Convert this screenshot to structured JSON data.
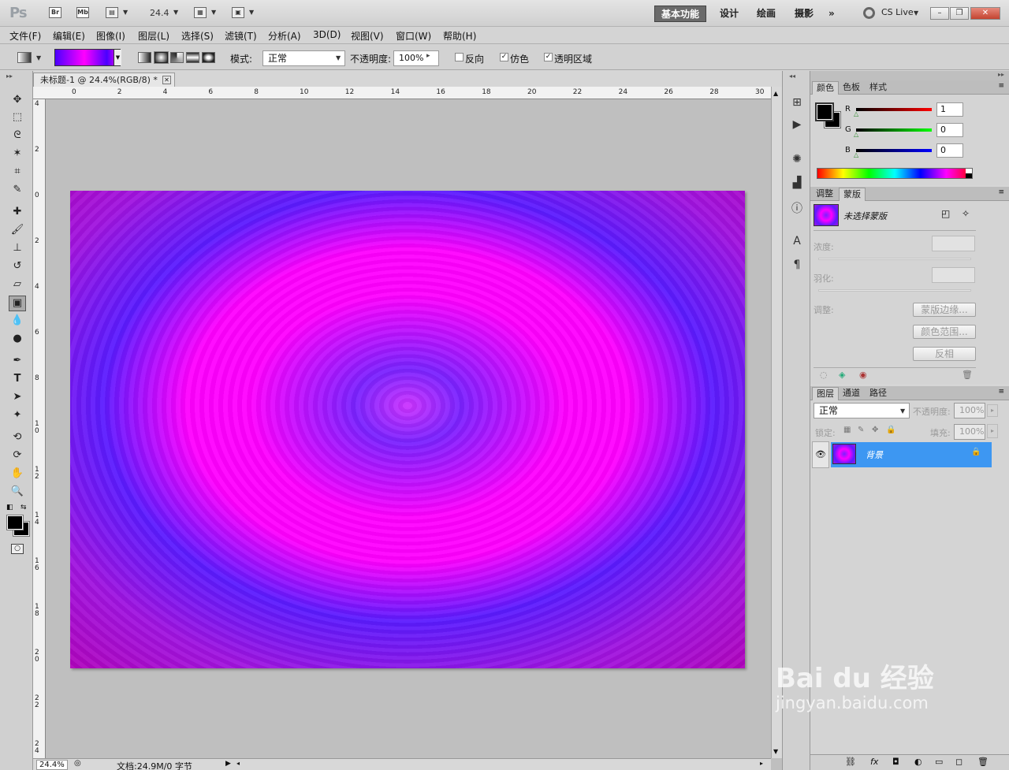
{
  "app": {
    "logo": "Ps",
    "br": "Br",
    "mb": "Mb",
    "zoom": "24.4",
    "workspaces": [
      "基本功能",
      "设计",
      "绘画",
      "摄影"
    ],
    "more": "»",
    "cs_live": "CS Live"
  },
  "menu": [
    "文件(F)",
    "编辑(E)",
    "图像(I)",
    "图层(L)",
    "选择(S)",
    "滤镜(T)",
    "分析(A)",
    "3D(D)",
    "视图(V)",
    "窗口(W)",
    "帮助(H)"
  ],
  "options": {
    "mode_label": "模式:",
    "mode_value": "正常",
    "opacity_label": "不透明度:",
    "opacity_value": "100%",
    "reverse": "反向",
    "dither": "仿色",
    "transparency": "透明区域"
  },
  "document": {
    "tab_title": "未标题-1 @ 24.4%(RGB/8) *",
    "status_zoom": "24.4%",
    "status_doc": "文档:24.9M/0 字节",
    "ruler_top": [
      "0",
      "2",
      "4",
      "6",
      "8",
      "10",
      "12",
      "14",
      "16",
      "18",
      "20",
      "22",
      "24",
      "26",
      "28",
      "30"
    ],
    "ruler_left": [
      "4",
      "2",
      "0",
      "2",
      "4",
      "6",
      "8",
      "1 0",
      "1 2",
      "1 4",
      "1 6",
      "1 8",
      "2 0",
      "2 2",
      "2 4"
    ]
  },
  "color_panel": {
    "tabs": [
      "颜色",
      "色板",
      "样式"
    ],
    "r_label": "R",
    "g_label": "G",
    "b_label": "B",
    "r_value": "1",
    "g_value": "0",
    "b_value": "0"
  },
  "mask_panel": {
    "tabs": [
      "调整",
      "蒙版"
    ],
    "no_mask": "未选择蒙版",
    "density": "浓度:",
    "feather": "羽化:",
    "adjust": "调整:",
    "mask_edge": "蒙版边缘...",
    "color_range": "颜色范围...",
    "invert": "反相"
  },
  "layers_panel": {
    "tabs": [
      "图层",
      "通道",
      "路径"
    ],
    "blend_mode": "正常",
    "opacity_label": "不透明度:",
    "opacity_value": "100%",
    "lock_label": "锁定:",
    "fill_label": "填充:",
    "fill_value": "100%",
    "layer_name": "背景"
  },
  "watermark": {
    "brand": "Bai du 经验",
    "url": "jingyan.baidu.com"
  }
}
